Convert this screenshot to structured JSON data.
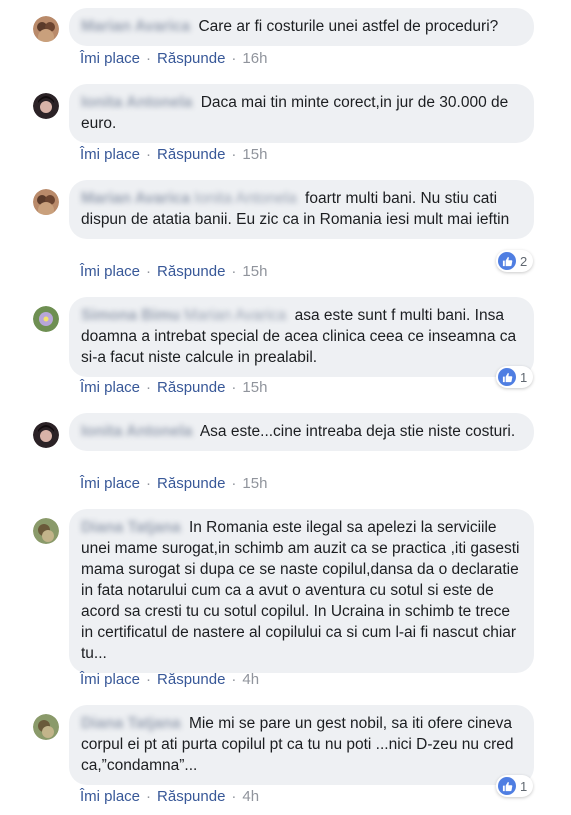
{
  "comments": [
    {
      "author": "Marian Avarica",
      "tagged": "",
      "text": "Care ar fi costurile unei astfel de proceduri?",
      "like_label": "Îmi place",
      "reply_label": "Răspunde",
      "time": "16h",
      "reactions": ""
    },
    {
      "author": "Ionita Antonela",
      "tagged": "",
      "text": "Daca mai tin minte corect,in jur de 30.000 de euro.",
      "like_label": "Îmi place",
      "reply_label": "Răspunde",
      "time": "15h",
      "reactions": ""
    },
    {
      "author": "Marian Avarica",
      "tagged": "Ionita Antonela",
      "text": "foartr multi bani. Nu stiu cati dispun de atatia banii. Eu zic ca in Romania iesi mult mai ieftin",
      "like_label": "Îmi place",
      "reply_label": "Răspunde",
      "time": "15h",
      "reactions": "2"
    },
    {
      "author": "Simona Bimu",
      "tagged": "Marian Avarica",
      "text": "asa este sunt f multi bani. Insa doamna a intrebat special de acea clinica ceea ce inseamna ca si-a facut niste calcule in prealabil.",
      "like_label": "Îmi place",
      "reply_label": "Răspunde",
      "time": "15h",
      "reactions": "1"
    },
    {
      "author": "Ionita Antonela",
      "tagged": "",
      "text": "Asa este...cine intreaba deja stie niste costuri.",
      "like_label": "Îmi place",
      "reply_label": "Răspunde",
      "time": "15h",
      "reactions": ""
    },
    {
      "author": "Diana Tatjana",
      "tagged": "",
      "text": "In Romania este ilegal sa apelezi la serviciile unei mame surogat,in schimb am auzit ca se practica ,iti gasesti mama surogat si dupa ce se naste copilul,dansa da o declaratie in fata notarului cum ca a avut o aventura cu sotul si este de acord sa cresti tu cu sotul copilul. In Ucraina in schimb te trece in certificatul de nastere al copilului ca si cum l-ai fi nascut chiar tu...",
      "like_label": "Îmi place",
      "reply_label": "Răspunde",
      "time": "4h",
      "reactions": ""
    },
    {
      "author": "Diana Tatjana",
      "tagged": "",
      "text": "Mie mi se pare un gest nobil, sa iti ofere cineva corpul ei pt ati purta copilul pt ca tu nu poti ...nici D-zeu nu cred ca,”condamna”...",
      "like_label": "Îmi place",
      "reply_label": "Răspunde",
      "time": "4h",
      "reactions": "1"
    }
  ],
  "colors": {
    "bubble": "#eef0f3",
    "link": "#385898",
    "meta": "#90949c",
    "like_blue": "#4f7ee2"
  },
  "icons": {
    "like": "thumbs-up-icon"
  }
}
